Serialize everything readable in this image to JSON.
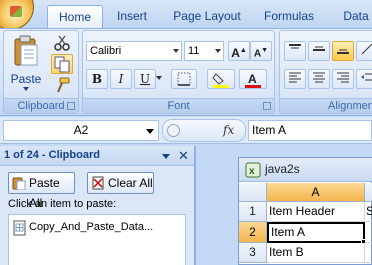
{
  "ribbon": {
    "tabs": [
      {
        "label": "Home",
        "active": true
      },
      {
        "label": "Insert",
        "active": false
      },
      {
        "label": "Page Layout",
        "active": false
      },
      {
        "label": "Formulas",
        "active": false
      },
      {
        "label": "Data",
        "active": false
      }
    ],
    "clipboard_group": {
      "label": "Clipboard",
      "paste_label": "Paste"
    },
    "font_group": {
      "label": "Font",
      "font_name": "Calibri",
      "font_size": "11",
      "bold": "B",
      "italic": "I",
      "underline": "U"
    },
    "alignment_group": {
      "label": "Alignmen"
    }
  },
  "formula_bar": {
    "name_box": "A2",
    "fx": "fx",
    "formula": "Item A"
  },
  "clipboard_pane": {
    "title": "1 of 24 - Clipboard",
    "paste_all": "Paste All",
    "clear_all": "Clear All",
    "instruction": "Click an item to paste:",
    "items": [
      "Copy_And_Paste_Data..."
    ]
  },
  "workbook": {
    "title": "java2s",
    "columns": [
      "A",
      "S"
    ],
    "rows": [
      {
        "num": "1",
        "a": "Item Header"
      },
      {
        "num": "2",
        "a": "Item A"
      },
      {
        "num": "3",
        "a": "Item B"
      }
    ]
  },
  "colors": {
    "accent": "#15428b",
    "selected_header": "#f4b44d",
    "ribbon_bg": "#d2e2f6"
  }
}
